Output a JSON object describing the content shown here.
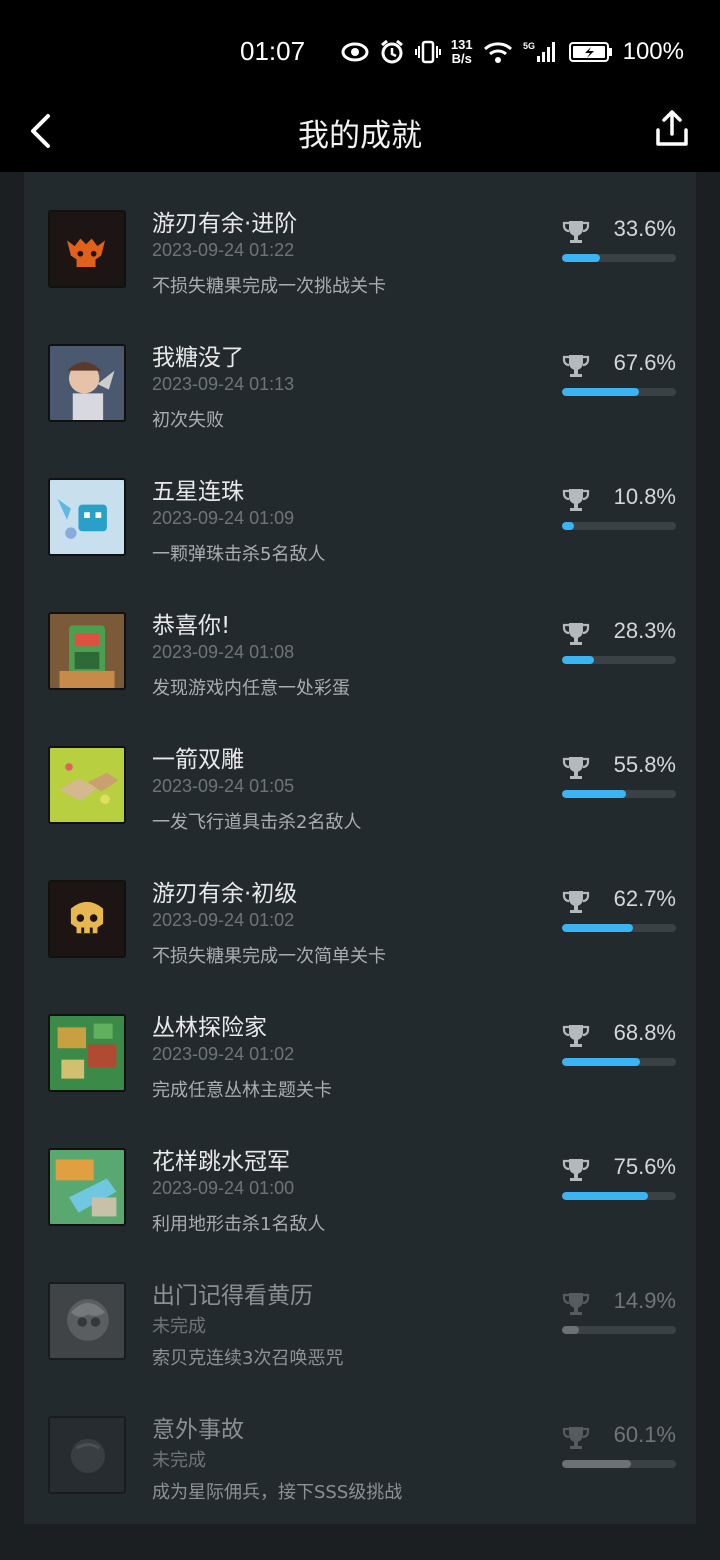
{
  "status_bar": {
    "time": "01:07",
    "net_speed_top": "131",
    "net_speed_bottom": "B/s",
    "battery": "100%",
    "icons": [
      "eye-icon",
      "alarm-icon",
      "vibrate-icon",
      "wifi-icon",
      "signal-5g-icon",
      "battery-icon"
    ]
  },
  "nav": {
    "title": "我的成就",
    "back_icon": "chevron-left-icon",
    "share_icon": "share-icon"
  },
  "colors": {
    "progress_fill": "#3ab4f2",
    "progress_fill_locked": "#6b7175",
    "card_bg": "#232a2e",
    "page_bg": "#1b1f22"
  },
  "achievements": [
    {
      "title": "游刃有余·进阶",
      "date": "2023-09-24 01:22",
      "desc": "不损失糖果完成一次挑战关卡",
      "percent": "33.6%",
      "progress": 0.336,
      "completed": true
    },
    {
      "title": "我糖没了",
      "date": "2023-09-24 01:13",
      "desc": "初次失败",
      "percent": "67.6%",
      "progress": 0.676,
      "completed": true
    },
    {
      "title": "五星连珠",
      "date": "2023-09-24 01:09",
      "desc": "一颗弹珠击杀5名敌人",
      "percent": "10.8%",
      "progress": 0.108,
      "completed": true
    },
    {
      "title": "恭喜你!",
      "date": "2023-09-24 01:08",
      "desc": "发现游戏内任意一处彩蛋",
      "percent": "28.3%",
      "progress": 0.283,
      "completed": true
    },
    {
      "title": "一箭双雕",
      "date": "2023-09-24 01:05",
      "desc": "一发飞行道具击杀2名敌人",
      "percent": "55.8%",
      "progress": 0.558,
      "completed": true
    },
    {
      "title": "游刃有余·初级",
      "date": "2023-09-24 01:02",
      "desc": "不损失糖果完成一次简单关卡",
      "percent": "62.7%",
      "progress": 0.627,
      "completed": true
    },
    {
      "title": "丛林探险家",
      "date": "2023-09-24 01:02",
      "desc": "完成任意丛林主题关卡",
      "percent": "68.8%",
      "progress": 0.688,
      "completed": true
    },
    {
      "title": "花样跳水冠军",
      "date": "2023-09-24 01:00",
      "desc": "利用地形击杀1名敌人",
      "percent": "75.6%",
      "progress": 0.756,
      "completed": true
    },
    {
      "title": "出门记得看黄历",
      "date": "未完成",
      "desc": "索贝克连续3次召唤恶咒",
      "percent": "14.9%",
      "progress": 0.149,
      "completed": false
    },
    {
      "title": "意外事故",
      "date": "未完成",
      "desc": "成为星际佣兵，接下SSS级挑战",
      "percent": "60.1%",
      "progress": 0.601,
      "completed": false
    }
  ]
}
